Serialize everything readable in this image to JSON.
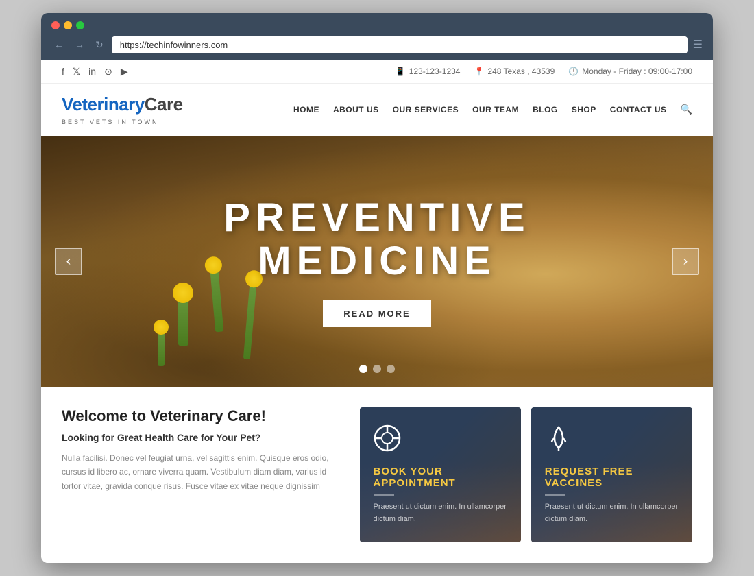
{
  "browser": {
    "url": "https://techinfowinners.com",
    "dots": [
      "red",
      "yellow",
      "green"
    ]
  },
  "topbar": {
    "social": [
      {
        "name": "facebook",
        "icon": "f"
      },
      {
        "name": "twitter",
        "icon": "𝕏"
      },
      {
        "name": "linkedin",
        "icon": "in"
      },
      {
        "name": "instagram",
        "icon": "◎"
      },
      {
        "name": "youtube",
        "icon": "▶"
      }
    ],
    "phone": "123-123-1234",
    "address": "248 Texas , 43539",
    "hours": "Monday - Friday : 09:00-17:00"
  },
  "header": {
    "logo_name_blue": "Veterinary",
    "logo_name_dark": "Care",
    "logo_tagline": "BEST VETS IN TOWN",
    "nav": [
      {
        "label": "HOME",
        "id": "home"
      },
      {
        "label": "ABOUT US",
        "id": "about"
      },
      {
        "label": "OUR SERVICES",
        "id": "services"
      },
      {
        "label": "OUR TEAM",
        "id": "team"
      },
      {
        "label": "BLOG",
        "id": "blog"
      },
      {
        "label": "SHOP",
        "id": "shop"
      },
      {
        "label": "CONTACT US",
        "id": "contact"
      }
    ]
  },
  "hero": {
    "title_line1": "PREVENTIVE",
    "title_line2": "MEDICINE",
    "cta": "READ MORE",
    "dots": [
      true,
      false,
      false
    ]
  },
  "welcome": {
    "title": "Welcome to Veterinary Care!",
    "subtitle": "Looking for Great Health Care for Your Pet?",
    "body": "Nulla facilisi. Donec vel feugiat urna, vel sagittis enim. Quisque eros odio, cursus id libero ac, ornare viverra quam. Vestibulum diam diam, varius id tortor vitae, gravida conque risus. Fusce vitae ex vitae neque dignissim"
  },
  "cards": [
    {
      "id": "appointment",
      "icon": "⊕",
      "title_white": "BOOK YOUR",
      "title_accent": "APPOINTMENT",
      "desc": "Praesent ut dictum enim. In ullamcorper dictum diam."
    },
    {
      "id": "vaccines",
      "icon": "⚕",
      "title_white": "REQUEST FREE",
      "title_accent": "VACCINES",
      "desc": "Praesent ut dictum enim. In ullamcorper dictum diam."
    }
  ],
  "colors": {
    "blue": "#1565c0",
    "accent": "#f5c842",
    "dark_navy": "#2c3e58",
    "text_dark": "#222",
    "text_muted": "#888"
  }
}
